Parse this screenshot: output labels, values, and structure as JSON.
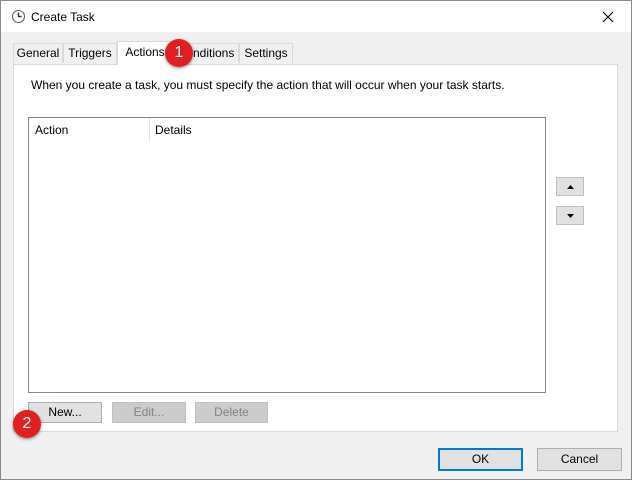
{
  "window": {
    "title": "Create Task",
    "icon": "task-scheduler-clock-icon",
    "close_icon": "close-icon"
  },
  "tabs": [
    {
      "label": "General",
      "active": false
    },
    {
      "label": "Triggers",
      "active": false
    },
    {
      "label": "Actions",
      "active": true
    },
    {
      "label": "Conditions",
      "active": false
    },
    {
      "label": "Settings",
      "active": false
    }
  ],
  "actions_panel": {
    "description": "When you create a task, you must specify the action that will occur when your task starts.",
    "columns": [
      "Action",
      "Details"
    ],
    "rows": [],
    "move_up_icon": "arrow-up-icon",
    "move_down_icon": "arrow-down-icon",
    "new_label": "New...",
    "edit_label": "Edit...",
    "delete_label": "Delete"
  },
  "footer": {
    "ok_label": "OK",
    "cancel_label": "Cancel"
  },
  "annotations": [
    {
      "number": "1"
    },
    {
      "number": "2"
    }
  ],
  "colors": {
    "badge": "#e02020",
    "focus_border": "#0078d7",
    "window_bg": "#f0f0f0"
  }
}
